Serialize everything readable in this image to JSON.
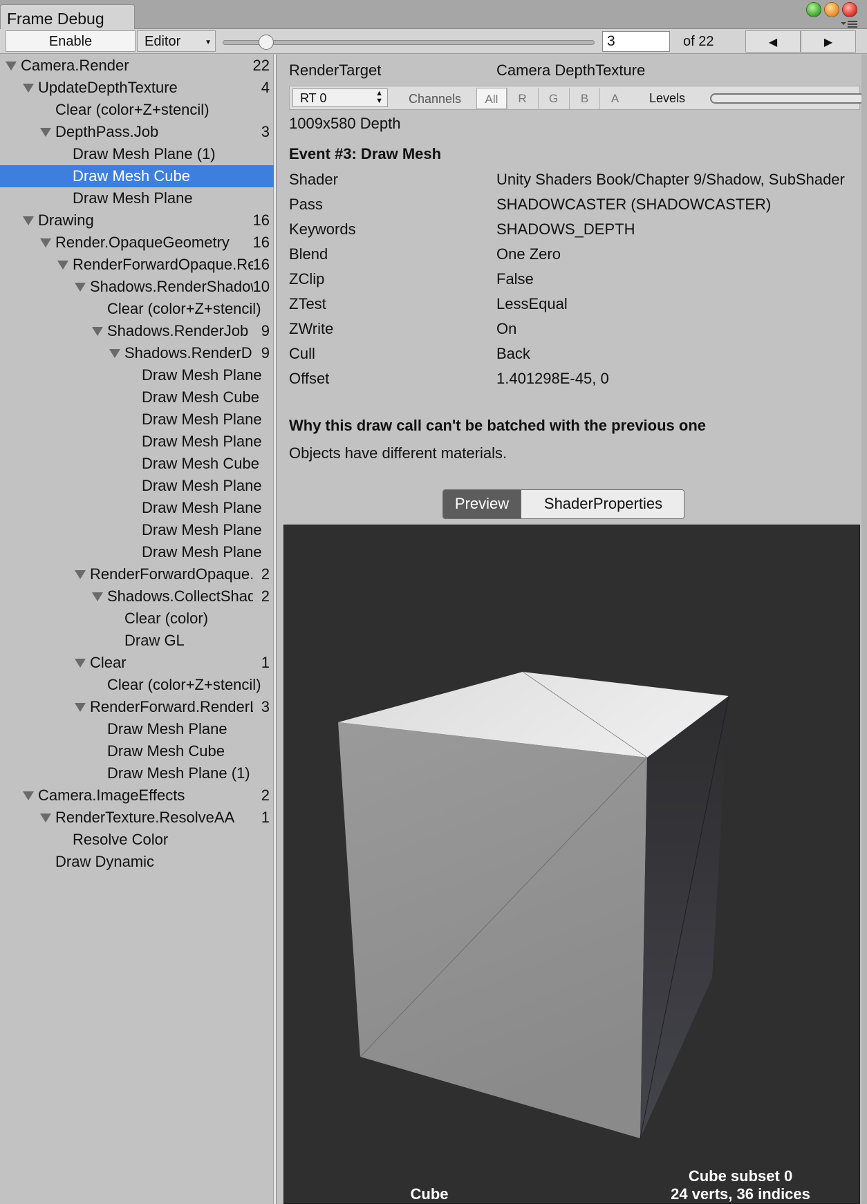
{
  "window": {
    "tab_title": "Frame Debug"
  },
  "toolbar": {
    "enable_label": "Enable",
    "editor_label": "Editor",
    "frame_index": "3",
    "of_label": "of 22",
    "event_slider_value": 3,
    "event_total": 22
  },
  "tree": {
    "items": [
      {
        "label": "Camera.Render",
        "count": "22",
        "depth": 0,
        "expanded": true
      },
      {
        "label": "UpdateDepthTexture",
        "count": "4",
        "depth": 1,
        "expanded": true
      },
      {
        "label": "Clear (color+Z+stencil)",
        "count": "",
        "depth": 2,
        "expanded": false
      },
      {
        "label": "DepthPass.Job",
        "count": "3",
        "depth": 2,
        "expanded": true
      },
      {
        "label": "Draw Mesh Plane (1)",
        "count": "",
        "depth": 3,
        "expanded": false
      },
      {
        "label": "Draw Mesh Cube",
        "count": "",
        "depth": 3,
        "expanded": false,
        "selected": true
      },
      {
        "label": "Draw Mesh Plane",
        "count": "",
        "depth": 3,
        "expanded": false
      },
      {
        "label": "Drawing",
        "count": "16",
        "depth": 1,
        "expanded": true
      },
      {
        "label": "Render.OpaqueGeometry",
        "count": "16",
        "depth": 2,
        "expanded": true
      },
      {
        "label": "RenderForwardOpaque.Render",
        "count": "16",
        "depth": 3,
        "expanded": true
      },
      {
        "label": "Shadows.RenderShadowmap",
        "count": "10",
        "depth": 4,
        "expanded": true
      },
      {
        "label": "Clear (color+Z+stencil)",
        "count": "",
        "depth": 5,
        "expanded": false
      },
      {
        "label": "Shadows.RenderJob",
        "count": "9",
        "depth": 5,
        "expanded": true
      },
      {
        "label": "Shadows.RenderDirJob",
        "count": "9",
        "depth": 6,
        "expanded": true
      },
      {
        "label": "Draw Mesh Plane",
        "count": "",
        "depth": 7,
        "expanded": false
      },
      {
        "label": "Draw Mesh Cube",
        "count": "",
        "depth": 7,
        "expanded": false
      },
      {
        "label": "Draw Mesh Plane",
        "count": "",
        "depth": 7,
        "expanded": false
      },
      {
        "label": "Draw Mesh Plane",
        "count": "",
        "depth": 7,
        "expanded": false
      },
      {
        "label": "Draw Mesh Cube",
        "count": "",
        "depth": 7,
        "expanded": false
      },
      {
        "label": "Draw Mesh Plane",
        "count": "",
        "depth": 7,
        "expanded": false
      },
      {
        "label": "Draw Mesh Plane",
        "count": "",
        "depth": 7,
        "expanded": false
      },
      {
        "label": "Draw Mesh Plane",
        "count": "",
        "depth": 7,
        "expanded": false
      },
      {
        "label": "Draw Mesh Plane",
        "count": "",
        "depth": 7,
        "expanded": false
      },
      {
        "label": "RenderForwardOpaque.CollectShadows",
        "count": "2",
        "depth": 4,
        "expanded": true
      },
      {
        "label": "Shadows.CollectShadows",
        "count": "2",
        "depth": 5,
        "expanded": true
      },
      {
        "label": "Clear (color)",
        "count": "",
        "depth": 6,
        "expanded": false
      },
      {
        "label": "Draw GL",
        "count": "",
        "depth": 6,
        "expanded": false
      },
      {
        "label": "Clear",
        "count": "1",
        "depth": 4,
        "expanded": true
      },
      {
        "label": "Clear (color+Z+stencil)",
        "count": "",
        "depth": 5,
        "expanded": false
      },
      {
        "label": "RenderForward.RenderLoopJob",
        "count": "3",
        "depth": 4,
        "expanded": true
      },
      {
        "label": "Draw Mesh Plane",
        "count": "",
        "depth": 5,
        "expanded": false
      },
      {
        "label": "Draw Mesh Cube",
        "count": "",
        "depth": 5,
        "expanded": false
      },
      {
        "label": "Draw Mesh Plane (1)",
        "count": "",
        "depth": 5,
        "expanded": false
      },
      {
        "label": "Camera.ImageEffects",
        "count": "2",
        "depth": 1,
        "expanded": true
      },
      {
        "label": "RenderTexture.ResolveAA",
        "count": "1",
        "depth": 2,
        "expanded": true
      },
      {
        "label": "Resolve Color",
        "count": "",
        "depth": 3,
        "expanded": false
      },
      {
        "label": "Draw Dynamic",
        "count": "",
        "depth": 2,
        "expanded": false
      }
    ]
  },
  "details": {
    "render_target_label": "RenderTarget",
    "render_target_value": "Camera DepthTexture",
    "rt_select": "RT 0",
    "channels_label": "Channels",
    "channels": [
      "All",
      "R",
      "G",
      "B",
      "A"
    ],
    "levels_label": "Levels",
    "resolution": "1009x580 Depth",
    "event_title": "Event #3: Draw Mesh",
    "properties": [
      {
        "label": "Shader",
        "value": "Unity Shaders Book/Chapter 9/Shadow, SubShader"
      },
      {
        "label": "Pass",
        "value": "SHADOWCASTER (SHADOWCASTER)"
      },
      {
        "label": "Keywords",
        "value": "SHADOWS_DEPTH"
      },
      {
        "label": "Blend",
        "value": "One Zero"
      },
      {
        "label": "ZClip",
        "value": "False"
      },
      {
        "label": "ZTest",
        "value": "LessEqual"
      },
      {
        "label": "ZWrite",
        "value": "On"
      },
      {
        "label": "Cull",
        "value": "Back"
      },
      {
        "label": "Offset",
        "value": "1.401298E-45, 0"
      }
    ],
    "batch_heading": "Why this draw call can't be batched with the previous one",
    "batch_reason": "Objects have different materials.",
    "tabs": [
      "Preview",
      "ShaderProperties"
    ],
    "preview_name": "Cube",
    "preview_subset": "Cube subset 0",
    "preview_stats": "24 verts, 36 indices"
  },
  "colors": {
    "selection": "#3e7fde",
    "panel": "#c2c2c2",
    "preview_bg": "#2f2f2f"
  }
}
